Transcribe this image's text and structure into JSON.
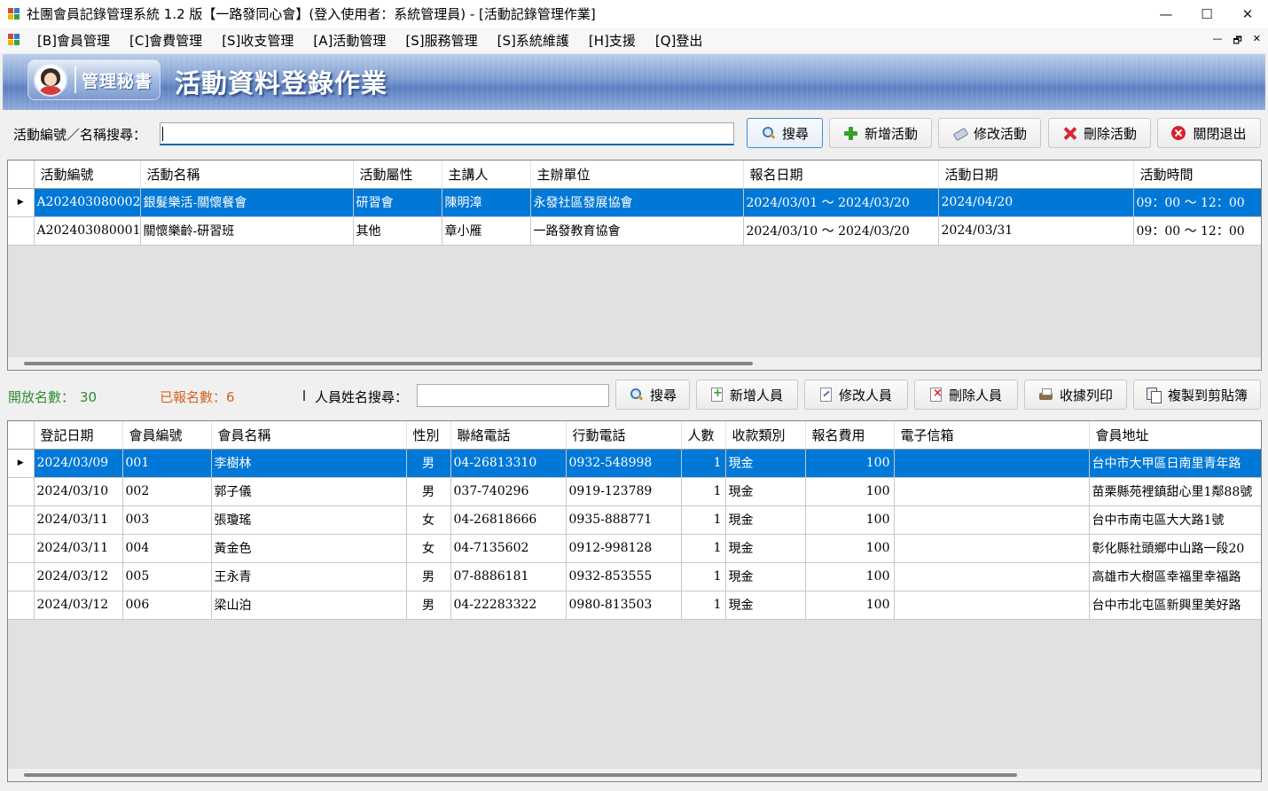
{
  "window": {
    "title": "社團會員記錄管理系統 1.2 版【一路發同心會】(登入使用者：系統管理員) - [活動記錄管理作業]",
    "minimize_glyph": "—",
    "maximize_glyph": "☐",
    "close_glyph": "✕"
  },
  "menu": {
    "items": [
      "[B]會員管理",
      "[C]會費管理",
      "[S]收支管理",
      "[A]活動管理",
      "[S]服務管理",
      "[S]系統維護",
      "[H]支援",
      "[Q]登出"
    ],
    "mdi_minimize": "—",
    "mdi_restore": "🗗",
    "mdi_close": "✕"
  },
  "banner": {
    "badge_text": "管理秘書",
    "title": "活動資料登錄作業"
  },
  "activity_search": {
    "label": "活動編號／名稱搜尋：",
    "value": "",
    "buttons": {
      "search": "搜尋",
      "add": "新增活動",
      "edit": "修改活動",
      "delete": "刪除活動",
      "close": "關閉退出"
    }
  },
  "activity_grid": {
    "columns": [
      "活動編號",
      "活動名稱",
      "活動屬性",
      "主講人",
      "主辦單位",
      "報名日期",
      "活動日期",
      "活動時間"
    ],
    "rows": [
      {
        "id": "A202403080002",
        "name": "銀髮樂活-關懷餐會",
        "type": "研習會",
        "speaker": "陳明漳",
        "host": "永發社區發展協會",
        "signup": "2024/03/01 ～ 2024/03/20",
        "date": "2024/04/20",
        "time": "09：00 ～ 12：00",
        "selected": true
      },
      {
        "id": "A202403080001",
        "name": "關懷樂齡-研習班",
        "type": "其他",
        "speaker": "章小雁",
        "host": "一路發教育協會",
        "signup": "2024/03/10 ～ 2024/03/20",
        "date": "2024/03/31",
        "time": "09：00 ～ 12：00",
        "selected": false
      }
    ]
  },
  "member_section": {
    "open_label": "開放名數：",
    "open_value": "30",
    "signed_label": "已報名數：",
    "signed_value": "6",
    "search_label": "人員姓名搜尋：",
    "search_value": "",
    "buttons": {
      "search": "搜尋",
      "add": "新增人員",
      "edit": "修改人員",
      "delete": "刪除人員",
      "print": "收據列印",
      "copy": "複製到剪貼簿"
    }
  },
  "member_grid": {
    "columns": [
      "登記日期",
      "會員編號",
      "會員名稱",
      "性別",
      "聯絡電話",
      "行動電話",
      "人數",
      "收款類別",
      "報名費用",
      "電子信箱",
      "會員地址"
    ],
    "rows": [
      {
        "date": "2024/03/09",
        "no": "001",
        "name": "李樹林",
        "gender": "男",
        "phone": "04-26813310",
        "mobile": "0932-548998",
        "count": "1",
        "pay": "現金",
        "fee": "100",
        "email": "",
        "address": "台中市大甲區日南里青年路",
        "selected": true
      },
      {
        "date": "2024/03/10",
        "no": "002",
        "name": "郭子儀",
        "gender": "男",
        "phone": "037-740296",
        "mobile": "0919-123789",
        "count": "1",
        "pay": "現金",
        "fee": "100",
        "email": "",
        "address": "苗栗縣苑裡鎮甜心里1鄰88號",
        "selected": false
      },
      {
        "date": "2024/03/11",
        "no": "003",
        "name": "張瓊瑤",
        "gender": "女",
        "phone": "04-26818666",
        "mobile": "0935-888771",
        "count": "1",
        "pay": "現金",
        "fee": "100",
        "email": "",
        "address": "台中市南屯區大大路1號",
        "selected": false
      },
      {
        "date": "2024/03/11",
        "no": "004",
        "name": "黃金色",
        "gender": "女",
        "phone": "04-7135602",
        "mobile": "0912-998128",
        "count": "1",
        "pay": "現金",
        "fee": "100",
        "email": "",
        "address": "彰化縣社頭鄉中山路一段20",
        "selected": false
      },
      {
        "date": "2024/03/12",
        "no": "005",
        "name": "王永青",
        "gender": "男",
        "phone": "07-8886181",
        "mobile": "0932-853555",
        "count": "1",
        "pay": "現金",
        "fee": "100",
        "email": "",
        "address": "高雄市大樹區幸福里幸福路",
        "selected": false
      },
      {
        "date": "2024/03/12",
        "no": "006",
        "name": "梁山泊",
        "gender": "男",
        "phone": "04-22283322",
        "mobile": "0980-813503",
        "count": "1",
        "pay": "現金",
        "fee": "100",
        "email": "",
        "address": "台中市北屯區新興里美好路",
        "selected": false
      }
    ]
  },
  "colors": {
    "selection": "#0078d7",
    "open_count": "#2e8b2e",
    "signed_count": "#d4621e"
  }
}
